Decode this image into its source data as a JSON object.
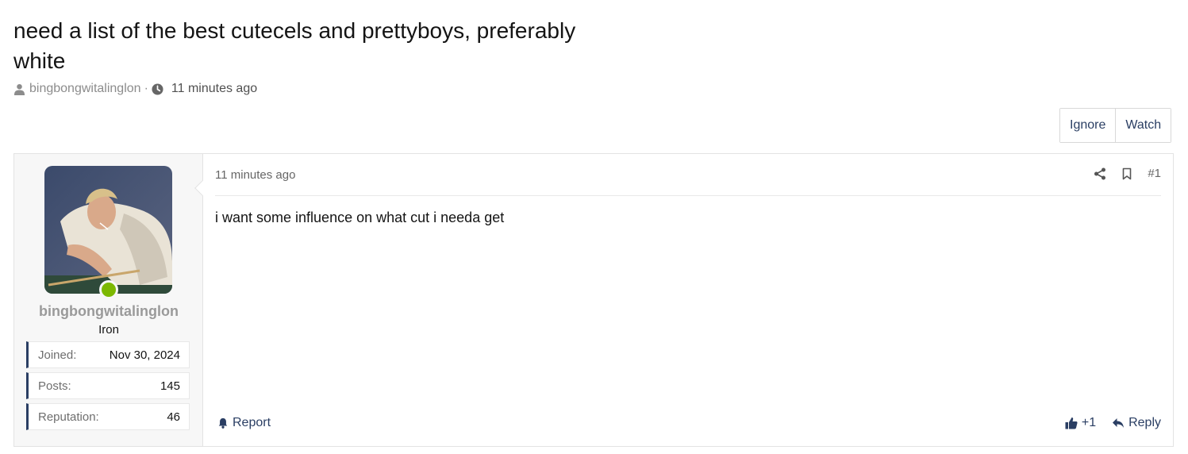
{
  "thread": {
    "title": "need a list of the best cutecels and prettyboys, preferably white",
    "author": "bingbongwitalinglon",
    "separator": "·",
    "time": "11 minutes ago"
  },
  "thread_actions": {
    "ignore_label": "Ignore",
    "watch_label": "Watch"
  },
  "post": {
    "user": {
      "name": "bingbongwitalinglon",
      "title": "Iron",
      "online": true,
      "stats": [
        {
          "label": "Joined:",
          "value": "Nov 30, 2024"
        },
        {
          "label": "Posts:",
          "value": "145"
        },
        {
          "label": "Reputation:",
          "value": "46"
        }
      ]
    },
    "time": "11 minutes ago",
    "number": "#1",
    "body": "i want some influence on what cut i needa get",
    "report_label": "Report",
    "like_count": "+1",
    "reply_label": "Reply"
  },
  "colors": {
    "link": "#2a3e63",
    "online": "#7cb800",
    "muted": "#8c8c8c"
  },
  "icons": [
    "user-icon",
    "clock-icon",
    "share-icon",
    "bookmark-icon",
    "bell-icon",
    "thumbs-up-icon",
    "reply-icon"
  ]
}
